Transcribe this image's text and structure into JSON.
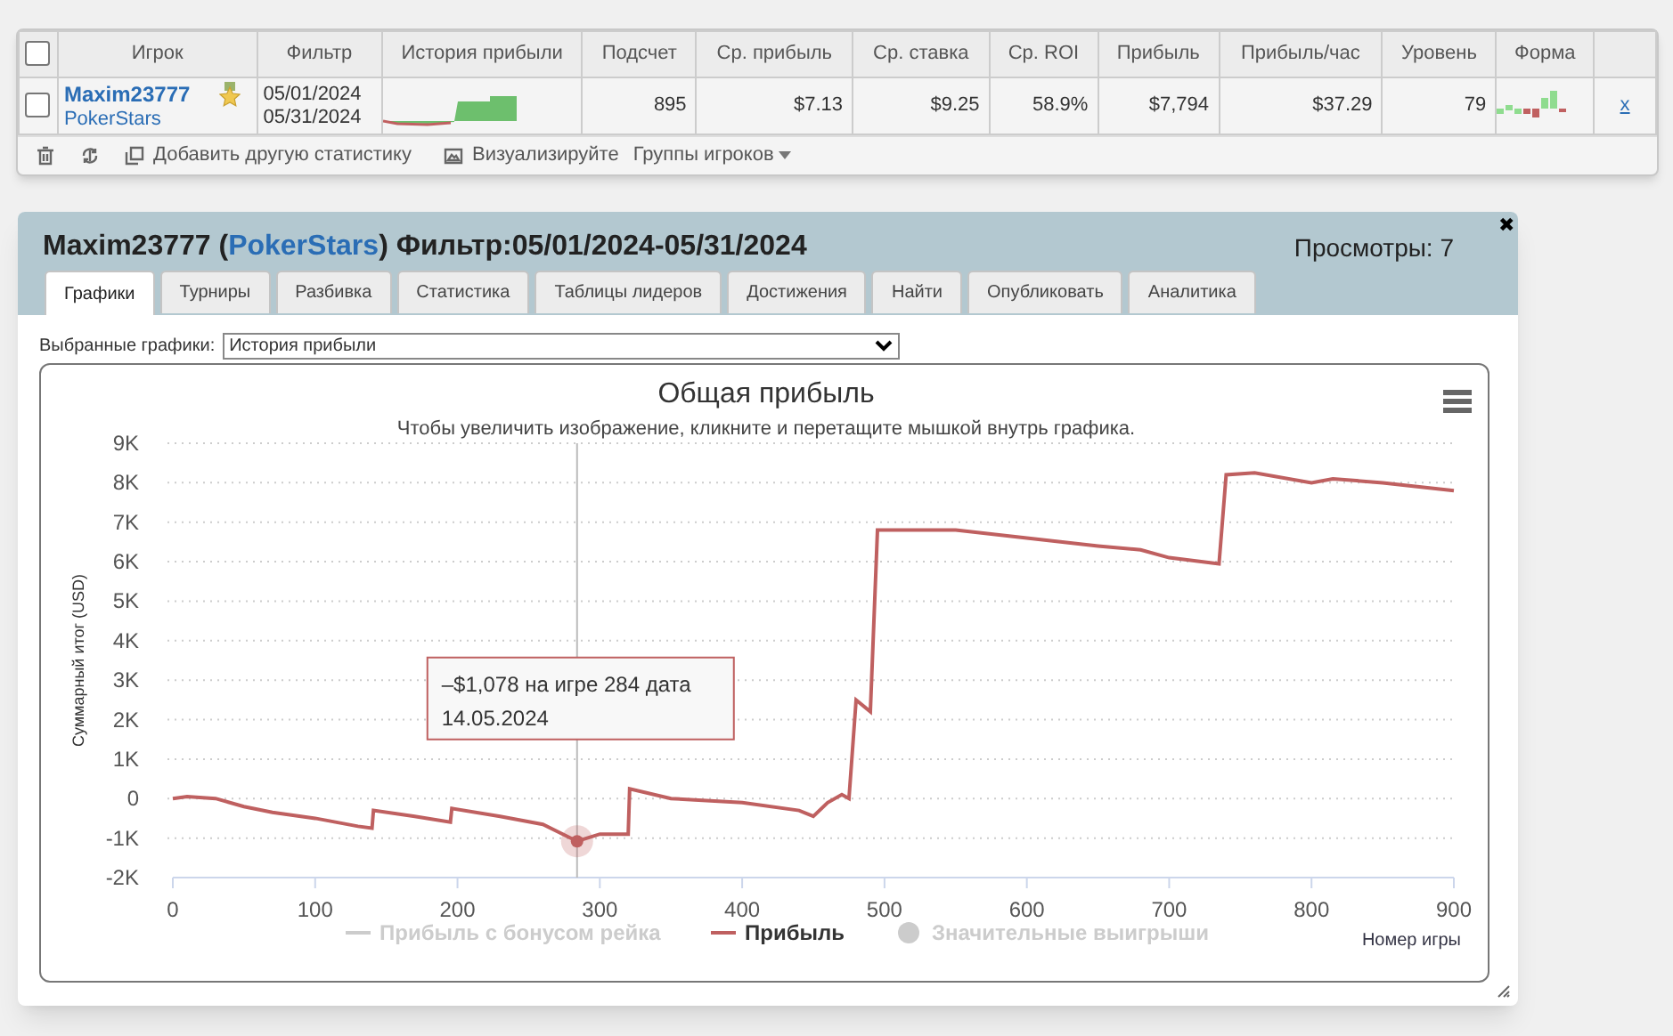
{
  "stats_table": {
    "select_all_checked": false,
    "columns": [
      "Игрок",
      "Фильтр",
      "История прибыли",
      "Подсчет",
      "Ср. прибыль",
      "Ср. ставка",
      "Ср. ROI",
      "Прибыль",
      "Прибыль/час",
      "Уровень",
      "Форма"
    ],
    "rows": [
      {
        "checked": false,
        "player": "Maxim23777",
        "site": "PokerStars",
        "filter": [
          "05/01/2024",
          "05/31/2024"
        ],
        "count": "895",
        "avg_profit": "$7.13",
        "avg_stake": "$9.25",
        "avg_roi": "58.9%",
        "profit": "$7,794",
        "profit_per_hour": "$37.29",
        "level": "79",
        "remove": "x"
      }
    ],
    "toolbar": [
      "Добавить другую статистику",
      "Визуализируйте",
      "Группы игроков"
    ]
  },
  "modal": {
    "title_before": "Maxim23777 (",
    "site_link": "PokerStars",
    "title_after": ") Фильтр:05/01/2024-05/31/2024",
    "views": "Просмотры: 7",
    "close": "✖",
    "tabs": [
      {
        "label": "Графики",
        "selected": true
      },
      {
        "label": "Турниры",
        "selected": false
      },
      {
        "label": "Разбивка",
        "selected": false
      },
      {
        "label": "Статистика",
        "selected": false
      },
      {
        "label": "Таблицы лидеров",
        "selected": false
      },
      {
        "label": "Достижения",
        "selected": false
      },
      {
        "label": "Найти",
        "selected": false
      },
      {
        "label": "Опубликовать",
        "selected": false
      },
      {
        "label": "Аналитика",
        "selected": false
      }
    ],
    "chart_select": {
      "label": "Выбранные графики:",
      "value": "История прибыли"
    },
    "chart": {
      "chart_data": {
        "type": "line",
        "title": "Общая прибыль",
        "xlabel": "Номер игры",
        "ylabel": "Суммарный итог (USD)",
        "x": [
          0,
          10,
          30,
          50,
          70,
          100,
          130,
          140,
          141,
          170,
          195,
          196,
          230,
          260,
          284,
          300,
          320,
          321,
          350,
          400,
          440,
          450,
          460,
          470,
          475,
          480,
          490,
          495,
          550,
          600,
          650,
          680,
          700,
          735,
          740,
          760,
          800,
          815,
          850,
          900
        ],
        "series": [
          {
            "name": "Прибыль",
            "color": "#bf6060",
            "values": [
              0,
              50,
              0,
              -200,
              -350,
              -500,
              -700,
              -750,
              -300,
              -450,
              -600,
              -250,
              -450,
              -650,
              -1080,
              -900,
              -900,
              250,
              0,
              -100,
              -300,
              -450,
              -100,
              100,
              0,
              2500,
              2200,
              6800,
              6800,
              6600,
              6400,
              6300,
              6100,
              5950,
              8200,
              8250,
              8000,
              8100,
              8000,
              7800
            ]
          }
        ],
        "xlim": [
          0,
          900
        ],
        "grid": true,
        "ref_lines": [
          {
            "axis": "x",
            "value": 284
          }
        ],
        "ylim": [
          -2000,
          9000
        ],
        "xticks": [
          0,
          100,
          200,
          300,
          400,
          500,
          600,
          700,
          800,
          900
        ],
        "yticks": [
          {
            "value": -2000,
            "label": "-2K"
          },
          {
            "value": -1000,
            "label": "-1K"
          },
          {
            "value": 0,
            "label": "0"
          },
          {
            "value": 1000,
            "label": "1K"
          },
          {
            "value": 2000,
            "label": "2K"
          },
          {
            "value": 3000,
            "label": "3K"
          },
          {
            "value": 4000,
            "label": "4K"
          },
          {
            "value": 5000,
            "label": "5K"
          },
          {
            "value": 6000,
            "label": "6K"
          },
          {
            "value": 7000,
            "label": "7K"
          },
          {
            "value": 8000,
            "label": "8K"
          },
          {
            "value": 9000,
            "label": "9K"
          }
        ]
      },
      "subtitle": "Чтобы увеличить изображение, кликните и перетащите мышкой внутрь графика.",
      "legend": [
        {
          "label": "Прибыль с бонусом рейка",
          "kind": "line",
          "visible": false
        },
        {
          "kind": "series",
          "visible": true
        },
        {
          "label": "Значительные выигрыши",
          "kind": "dot",
          "visible": false
        }
      ],
      "tooltip": {
        "lines": [
          "–$1,078 на игре 284 дата",
          "14.05.2024"
        ]
      }
    }
  }
}
